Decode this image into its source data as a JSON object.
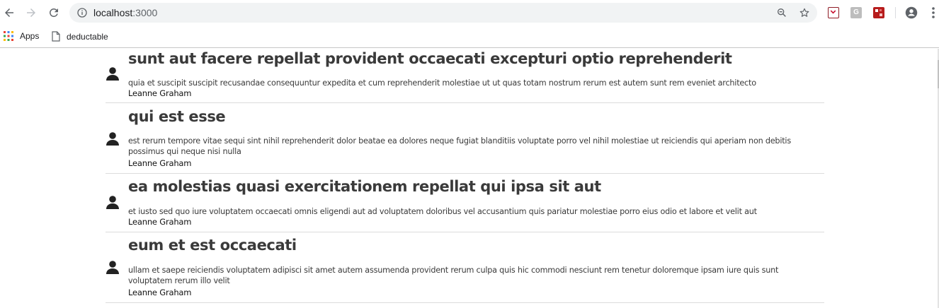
{
  "browser": {
    "url_host": "localhost",
    "url_port": ":3000",
    "bookmarks": [
      {
        "label": "Apps",
        "icon": "apps-grid-icon"
      },
      {
        "label": "deductable",
        "icon": "page-icon"
      }
    ],
    "extensions": [
      {
        "icon": "pocket-extension-icon",
        "color": "#c8102e"
      },
      {
        "icon": "g-extension-icon",
        "color": "#bdbdbd",
        "letter": "G"
      },
      {
        "icon": "red-extension-icon",
        "color": "#b71c1c"
      }
    ]
  },
  "posts": [
    {
      "title": "sunt aut facere repellat provident occaecati excepturi optio reprehenderit",
      "body": "quia et suscipit suscipit recusandae consequuntur expedita et cum reprehenderit molestiae ut ut quas totam nostrum rerum est autem sunt rem eveniet architecto",
      "author": "Leanne Graham"
    },
    {
      "title": "qui est esse",
      "body": "est rerum tempore vitae sequi sint nihil reprehenderit dolor beatae ea dolores neque fugiat blanditiis voluptate porro vel nihil molestiae ut reiciendis qui aperiam non debitis possimus qui neque nisi nulla",
      "author": "Leanne Graham"
    },
    {
      "title": "ea molestias quasi exercitationem repellat qui ipsa sit aut",
      "body": "et iusto sed quo iure voluptatem occaecati omnis eligendi aut ad voluptatem doloribus vel accusantium quis pariatur molestiae porro eius odio et labore et velit aut",
      "author": "Leanne Graham"
    },
    {
      "title": "eum et est occaecati",
      "body": "ullam et saepe reiciendis voluptatem adipisci sit amet autem assumenda provident rerum culpa quis hic commodi nesciunt rem tenetur doloremque ipsam iure quis sunt voluptatem rerum illo velit",
      "author": "Leanne Graham"
    }
  ]
}
